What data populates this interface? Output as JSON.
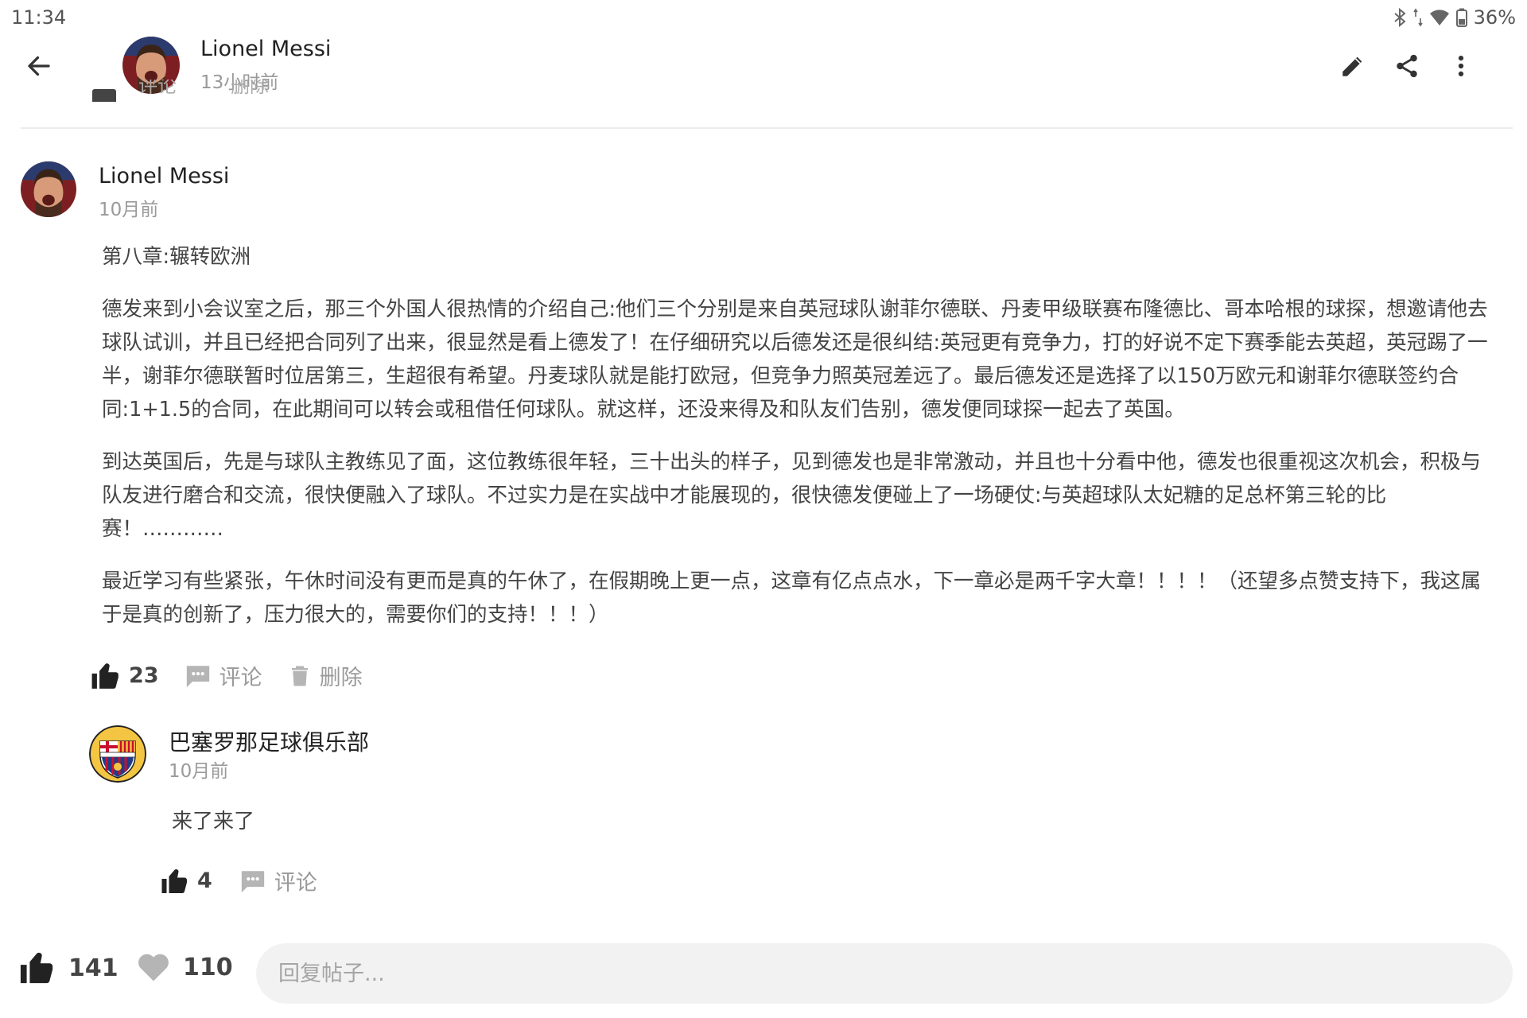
{
  "status_bar": {
    "time": "11:34",
    "battery": "36%"
  },
  "header": {
    "author": "Lionel  Messi",
    "time": "13小时前",
    "ghost_actions": [
      "评论",
      "删除"
    ]
  },
  "post": {
    "author": "Lionel  Messi",
    "time": "10月前",
    "title": "第八章:辗转欧洲",
    "paragraphs": [
      "德发来到小会议室之后，那三个外国人很热情的介绍自己:他们三个分别是来自英冠球队谢菲尔德联、丹麦甲级联赛布隆德比、哥本哈根的球探，想邀请他去球队试训，并且已经把合同列了出来，很显然是看上德发了！在仔细研究以后德发还是很纠结:英冠更有竞争力，打的好说不定下赛季能去英超，英冠踢了一半，谢菲尔德联暂时位居第三，生超很有希望。丹麦球队就是能打欧冠，但竞争力照英冠差远了。最后德发还是选择了以150万欧元和谢菲尔德联签约合同:1+1.5的合同，在此期间可以转会或租借任何球队。就这样，还没来得及和队友们告别，德发便同球探一起去了英国。",
      "到达英国后，先是与球队主教练见了面，这位教练很年轻，三十出头的样子，见到德发也是非常激动，并且也十分看中他，德发也很重视这次机会，积极与队友进行磨合和交流，很快便融入了球队。不过实力是在实战中才能展现的，很快德发便碰上了一场硬仗:与英超球队太妃糖的足总杯第三轮的比赛！…………",
      "最近学习有些紧张，午休时间没有更而是真的午休了，在假期晚上更一点，这章有亿点点水，下一章必是两千字大章！！！！（还望多点赞支持下，我这属于是真的创新了，压力很大的，需要你们的支持！！！）"
    ],
    "likes": "23",
    "comment_label": "评论",
    "delete_label": "删除"
  },
  "comment": {
    "author": "巴塞罗那足球俱乐部",
    "time": "10月前",
    "text": "来了来了",
    "likes": "4",
    "comment_label": "评论"
  },
  "bottom_bar": {
    "likes": "141",
    "favorites": "110",
    "reply_placeholder": "回复帖子..."
  },
  "colors": {
    "icon_dark": "#222222",
    "icon_gray": "#b5b5b5",
    "text_gray": "#9a9a9a",
    "input_bg": "#f2f2f2"
  }
}
